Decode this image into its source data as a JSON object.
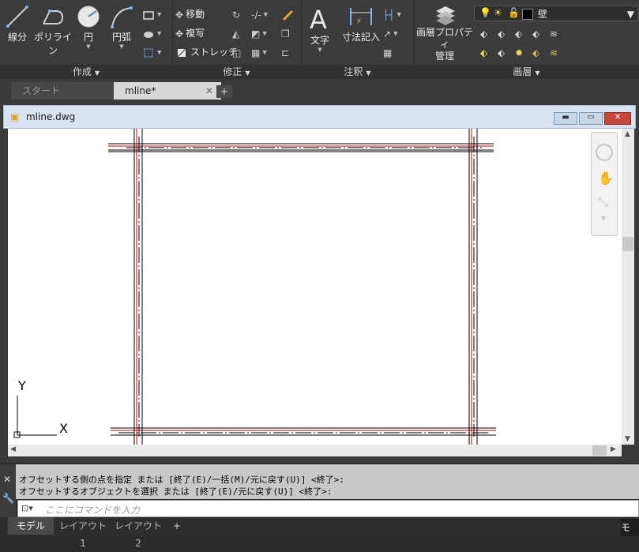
{
  "ribbon": {
    "draw_panel": {
      "title": "作成",
      "line": "線分",
      "polyline": "ポリライン",
      "circle": "円",
      "arc": "円弧"
    },
    "modify_panel": {
      "title": "修正",
      "move": "移動",
      "copy": "複写",
      "stretch": "ストレッチ"
    },
    "annotation_panel": {
      "title": "注釈",
      "text": "文字",
      "dimension": "寸法記入"
    },
    "layers_panel": {
      "title": "画層",
      "layer_properties_line1": "画層プロパティ",
      "layer_properties_line2": "管理",
      "current_layer": "壁"
    }
  },
  "file_tabs": [
    {
      "label": "スタート",
      "active": false
    },
    {
      "label": "mline*",
      "active": true
    }
  ],
  "drawing_window": {
    "title": "mline.dwg"
  },
  "ucs": {
    "x_label": "X",
    "y_label": "Y"
  },
  "command": {
    "history": [
      "オフセットする側の点を指定 または [終了(E)/一括(M)/元に戻す(U)] <終了>:",
      "オフセットするオブジェクトを選択 または [終了(E)/元に戻す(U)] <終了>:"
    ],
    "placeholder": "ここにコマンドを入力"
  },
  "layout_tabs": [
    {
      "label": "モデル",
      "active": true
    },
    {
      "label": "レイアウト1",
      "active": false
    },
    {
      "label": "レイアウト2",
      "active": false
    }
  ],
  "status": {
    "model_label": "モデ"
  },
  "colors": {
    "ribbon_bg": "#3b3b3b",
    "centerline_red": "#c00000",
    "canvas_bg": "#ffffff"
  }
}
